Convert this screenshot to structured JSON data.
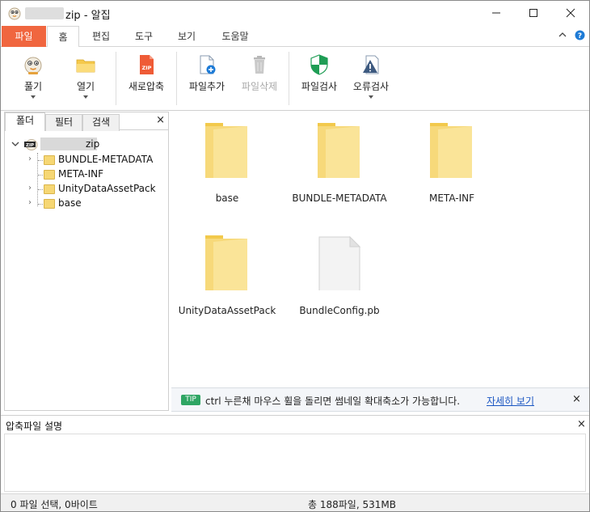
{
  "window": {
    "title": "zip - 알집",
    "accent": "#f0663f"
  },
  "ribbon": {
    "tabs": [
      "파일",
      "홈",
      "편집",
      "도구",
      "보기",
      "도움말"
    ],
    "active_tab": "홈"
  },
  "toolbar": {
    "buttons": [
      {
        "label": "풀기",
        "icon": "extract-icon",
        "has_dropdown": true,
        "enabled": true
      },
      {
        "label": "열기",
        "icon": "open-folder-icon",
        "has_dropdown": true,
        "enabled": true
      },
      {
        "label": "새로압축",
        "icon": "new-zip-icon",
        "has_dropdown": false,
        "enabled": true
      },
      {
        "label": "파일추가",
        "icon": "add-file-icon",
        "has_dropdown": false,
        "enabled": true
      },
      {
        "label": "파일삭제",
        "icon": "trash-icon",
        "has_dropdown": false,
        "enabled": false
      },
      {
        "label": "파일검사",
        "icon": "shield-icon",
        "has_dropdown": false,
        "enabled": true
      },
      {
        "label": "오류검사",
        "icon": "warning-icon",
        "has_dropdown": true,
        "enabled": true
      }
    ],
    "zip_icon_text": "ZIP"
  },
  "leftpanel": {
    "tabs": [
      "폴더",
      "필터",
      "검색"
    ],
    "active_tab": "폴더",
    "close": "×",
    "tree": {
      "root_label": "zip",
      "root_icon_text": "ZIP",
      "children": [
        {
          "label": "BUNDLE-METADATA",
          "expandable": true
        },
        {
          "label": "META-INF",
          "expandable": false
        },
        {
          "label": "UnityDataAssetPack",
          "expandable": true
        },
        {
          "label": "base",
          "expandable": true
        }
      ]
    }
  },
  "files": [
    {
      "name": "base",
      "type": "folder"
    },
    {
      "name": "BUNDLE-METADATA",
      "type": "folder"
    },
    {
      "name": "META-INF",
      "type": "folder"
    },
    {
      "name": "UnityDataAssetPack",
      "type": "folder"
    },
    {
      "name": "BundleConfig.pb",
      "type": "file"
    }
  ],
  "tip": {
    "badge": "TIP",
    "text": "ctrl 누른채 마우스 휠을 돌리면 썸네일 확대축소가 가능합니다.",
    "link": "자세히 보기",
    "close": "×"
  },
  "description": {
    "title": "압축파일 설명",
    "close": "×"
  },
  "status": {
    "left": "0 파일 선택,  0바이트",
    "right": "총 188파일,  531MB"
  }
}
